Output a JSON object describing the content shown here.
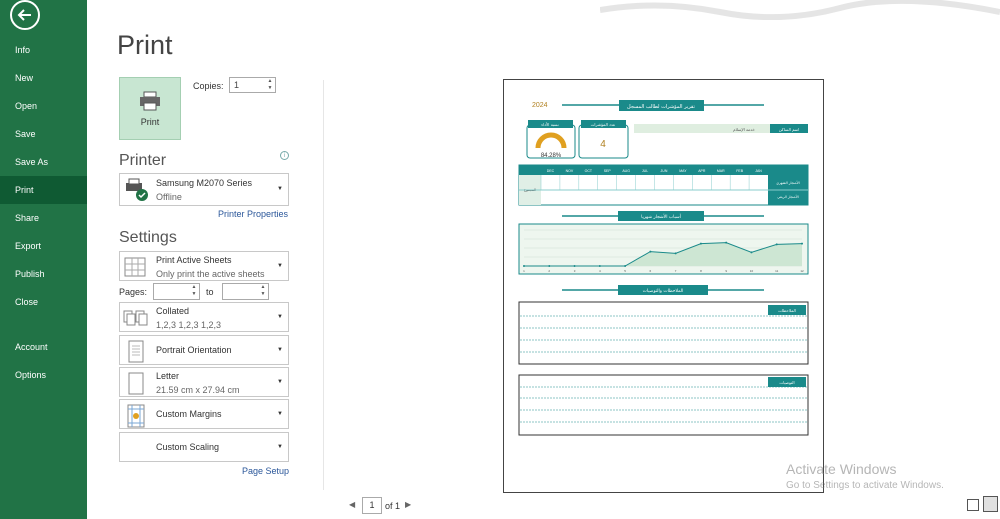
{
  "nav": {
    "items": [
      {
        "label": "Info"
      },
      {
        "label": "New"
      },
      {
        "label": "Open"
      },
      {
        "label": "Save"
      },
      {
        "label": "Save As"
      },
      {
        "label": "Print"
      },
      {
        "label": "Share"
      },
      {
        "label": "Export"
      },
      {
        "label": "Publish"
      },
      {
        "label": "Close"
      },
      {
        "label": "Account"
      },
      {
        "label": "Options"
      }
    ],
    "active": "Print",
    "back_icon": "back-arrow-icon"
  },
  "title": "Print",
  "print_button": {
    "label": "Print",
    "icon": "printer-icon"
  },
  "copies": {
    "label": "Copies:",
    "value": "1"
  },
  "printer": {
    "section_title": "Printer",
    "name": "Samsung M2070 Series",
    "status": "Offline",
    "properties_link": "Printer Properties"
  },
  "settings": {
    "section_title": "Settings",
    "sheets": {
      "main": "Print Active Sheets",
      "sub": "Only print the active sheets"
    },
    "pages_label": "Pages:",
    "to_label": "to",
    "collation": {
      "main": "Collated",
      "sub": "1,2,3    1,2,3    1,2,3"
    },
    "orientation": {
      "main": "Portrait Orientation"
    },
    "paper": {
      "main": "Letter",
      "sub": "21.59 cm x 27.94 cm"
    },
    "margins": {
      "main": "Custom Margins"
    },
    "scaling": {
      "main": "Custom Scaling"
    },
    "page_setup_link": "Page Setup"
  },
  "preview": {
    "year": "2024",
    "header": "تقرير المؤشرات لطالب المسجل",
    "kpi_1": {
      "label": "نسبة الأداء",
      "value": "84.28%"
    },
    "kpi_2": {
      "label": "عدد المؤشرات",
      "value": "4"
    },
    "name_label": "اسم الساكن",
    "name_value": "خدمة الإسلام",
    "months": [
      "DEC",
      "NOV",
      "OCT",
      "SEP",
      "AUG",
      "JUL",
      "JUN",
      "MAY",
      "APR",
      "MAR",
      "FEB",
      "JAN"
    ],
    "row_1_label": "الأشجار الشهري",
    "row_2_label": "الأشجار الربعي",
    "total_label": "المجموع",
    "chart_title": "أسباب الأشجار شهريا",
    "section_3": "الملاحظات والتوصيات",
    "notes_label": "الملاحظات",
    "recommendations_label": "التوصيات"
  },
  "chart_data": {
    "type": "line",
    "categories": [
      "1",
      "2",
      "3",
      "4",
      "5",
      "6",
      "7",
      "8",
      "9",
      "10",
      "11",
      "12"
    ],
    "values": [
      0,
      0,
      0,
      0,
      0,
      40,
      35,
      62,
      65,
      38,
      60,
      62
    ],
    "ylim": [
      0,
      100
    ],
    "grid": true
  },
  "pager": {
    "current": "1",
    "of": "of 1"
  },
  "watermark": {
    "title": "Activate Windows",
    "sub": "Go to Settings to activate Windows."
  },
  "colors": {
    "nav_green": "#217346",
    "teal": "#1a8a8a",
    "print_button_bg": "#c8e6d2"
  }
}
